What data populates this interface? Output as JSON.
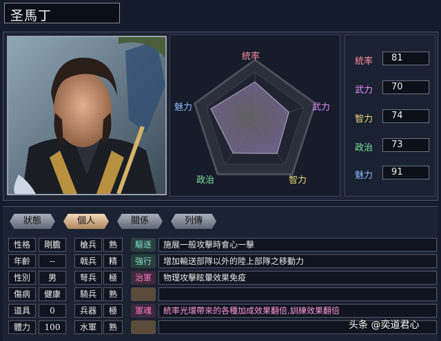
{
  "character": {
    "name": "圣馬丁"
  },
  "radar": {
    "labels": {
      "lead": "統率",
      "war": "武力",
      "int": "智力",
      "pol": "政治",
      "cha": "魅力"
    },
    "values": {
      "lead": 81,
      "war": 70,
      "int": 74,
      "pol": 73,
      "cha": 91
    },
    "max": 100
  },
  "stats": [
    {
      "label": "統率",
      "value": "81",
      "color": "#ff8fa3"
    },
    {
      "label": "武力",
      "value": "70",
      "color": "#e98bff"
    },
    {
      "label": "智力",
      "value": "74",
      "color": "#f0d777"
    },
    {
      "label": "政治",
      "value": "73",
      "color": "#7ee8a2"
    },
    {
      "label": "魅力",
      "value": "91",
      "color": "#8ab8ff"
    }
  ],
  "tabs": [
    "狀態",
    "個人",
    "關係",
    "列傳"
  ],
  "active_tab": "個人",
  "personal": [
    {
      "label": "性格",
      "value": "剛膽"
    },
    {
      "label": "年齡",
      "value": "--"
    },
    {
      "label": "性別",
      "value": "男"
    },
    {
      "label": "傷病",
      "value": "健康"
    },
    {
      "label": "道具",
      "value": "0"
    },
    {
      "label": "體力",
      "value": "100"
    }
  ],
  "weapons": [
    {
      "label": "槍兵",
      "value": "熟"
    },
    {
      "label": "戟兵",
      "value": "精"
    },
    {
      "label": "弩兵",
      "value": "極"
    },
    {
      "label": "騎兵",
      "value": "熟"
    },
    {
      "label": "兵器",
      "value": "極"
    },
    {
      "label": "水軍",
      "value": "熟"
    }
  ],
  "skills": [
    {
      "tag": "驅逐",
      "desc": "施展一般攻擊時會心一擊",
      "tag_color": "#7fe0d0",
      "desc_color": "#e8e8e8"
    },
    {
      "tag": "強行",
      "desc": "增加輸送部隊以外的陸上部隊之移動力",
      "tag_color": "#7fe0d0",
      "desc_color": "#e8e8e8"
    },
    {
      "tag": "治軍",
      "desc": "物理攻擊眩暈效果免疫",
      "tag_color": "#ff77c8",
      "desc_color": "#e8e8e8"
    },
    {
      "tag": "",
      "desc": "",
      "tag_color": "",
      "desc_color": ""
    },
    {
      "tag": "軍魂",
      "desc": "統率光環帶來的各種加成效果翻倍,訓練效果翻倍",
      "tag_color": "#ff77c8",
      "desc_color": "#ff9ad1"
    },
    {
      "tag": "",
      "desc": "",
      "tag_color": "",
      "desc_color": ""
    }
  ],
  "watermark": "头条 @奕道君心"
}
